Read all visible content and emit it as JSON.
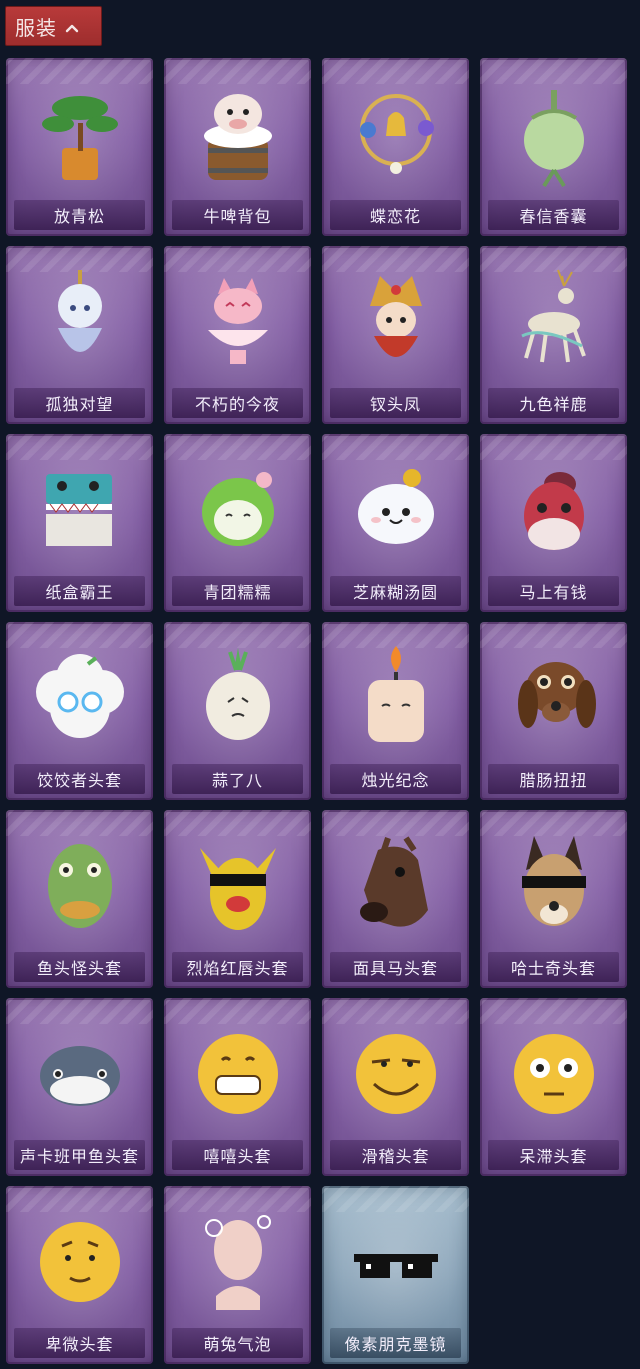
{
  "section": {
    "title": "服装",
    "expand_icon": "chevron-up-icon"
  },
  "items": [
    {
      "label": "放青松",
      "icon": "bonsai-pine-icon",
      "color": "#3f8f3a"
    },
    {
      "label": "牛啤背包",
      "icon": "cow-beer-barrel-icon",
      "color": "#c98a4a"
    },
    {
      "label": "蝶恋花",
      "icon": "butterfly-flower-bell-icon",
      "color": "#d9b152"
    },
    {
      "label": "春信香囊",
      "icon": "sachet-pouch-icon",
      "color": "#b9d9a0"
    },
    {
      "label": "孤独对望",
      "icon": "ice-doll-pendant-icon",
      "color": "#c9d6f0"
    },
    {
      "label": "不朽的今夜",
      "icon": "pink-fox-bowl-icon",
      "color": "#f2a0b8"
    },
    {
      "label": "钗头凤",
      "icon": "phoenix-crown-doll-icon",
      "color": "#d9a23a"
    },
    {
      "label": "九色祥鹿",
      "icon": "nine-color-deer-icon",
      "color": "#e8e2d0"
    },
    {
      "label": "纸盒霸王",
      "icon": "box-dinosaur-icon",
      "color": "#3fa6b0"
    },
    {
      "label": "青团糯糯",
      "icon": "green-dumpling-icon",
      "color": "#7bc64a"
    },
    {
      "label": "芝麻糊汤圆",
      "icon": "white-rice-ball-icon",
      "color": "#f2f4f8"
    },
    {
      "label": "马上有钱",
      "icon": "red-horse-head-icon",
      "color": "#c23a4a"
    },
    {
      "label": "饺饺者头套",
      "icon": "dumpling-cloud-head-icon",
      "color": "#f6f6f6"
    },
    {
      "label": "蒜了八",
      "icon": "garlic-head-icon",
      "color": "#f1ece0"
    },
    {
      "label": "烛光纪念",
      "icon": "candle-head-icon",
      "color": "#f4dcc8"
    },
    {
      "label": "腊肠扭扭",
      "icon": "dachshund-head-icon",
      "color": "#7a4a2a"
    },
    {
      "label": "鱼头怪头套",
      "icon": "fish-mask-icon",
      "color": "#7fae5a"
    },
    {
      "label": "烈焰红唇头套",
      "icon": "yellow-pikachu-mask-icon",
      "color": "#e6c42a"
    },
    {
      "label": "面具马头套",
      "icon": "horse-mask-icon",
      "color": "#5a3a2a"
    },
    {
      "label": "哈士奇头套",
      "icon": "husky-sunglasses-icon",
      "color": "#c8a070"
    },
    {
      "label": "声卡班甲鱼头套",
      "icon": "whale-head-icon",
      "color": "#5a6a80"
    },
    {
      "label": "嘻嘻头套",
      "icon": "grinning-emoji-icon",
      "color": "#f2c23a"
    },
    {
      "label": "滑稽头套",
      "icon": "funny-emoji-icon",
      "color": "#f2c23a"
    },
    {
      "label": "呆滞头套",
      "icon": "dazed-emoji-icon",
      "color": "#f2c23a"
    },
    {
      "label": "卑微头套",
      "icon": "humble-emoji-icon",
      "color": "#f2c23a"
    },
    {
      "label": "萌兔气泡",
      "icon": "bunny-bubble-icon",
      "color": "#f0d0c8"
    },
    {
      "label": "像素朋克墨镜",
      "icon": "pixel-sunglasses-icon",
      "color": "#111111",
      "variant": "blue"
    }
  ]
}
